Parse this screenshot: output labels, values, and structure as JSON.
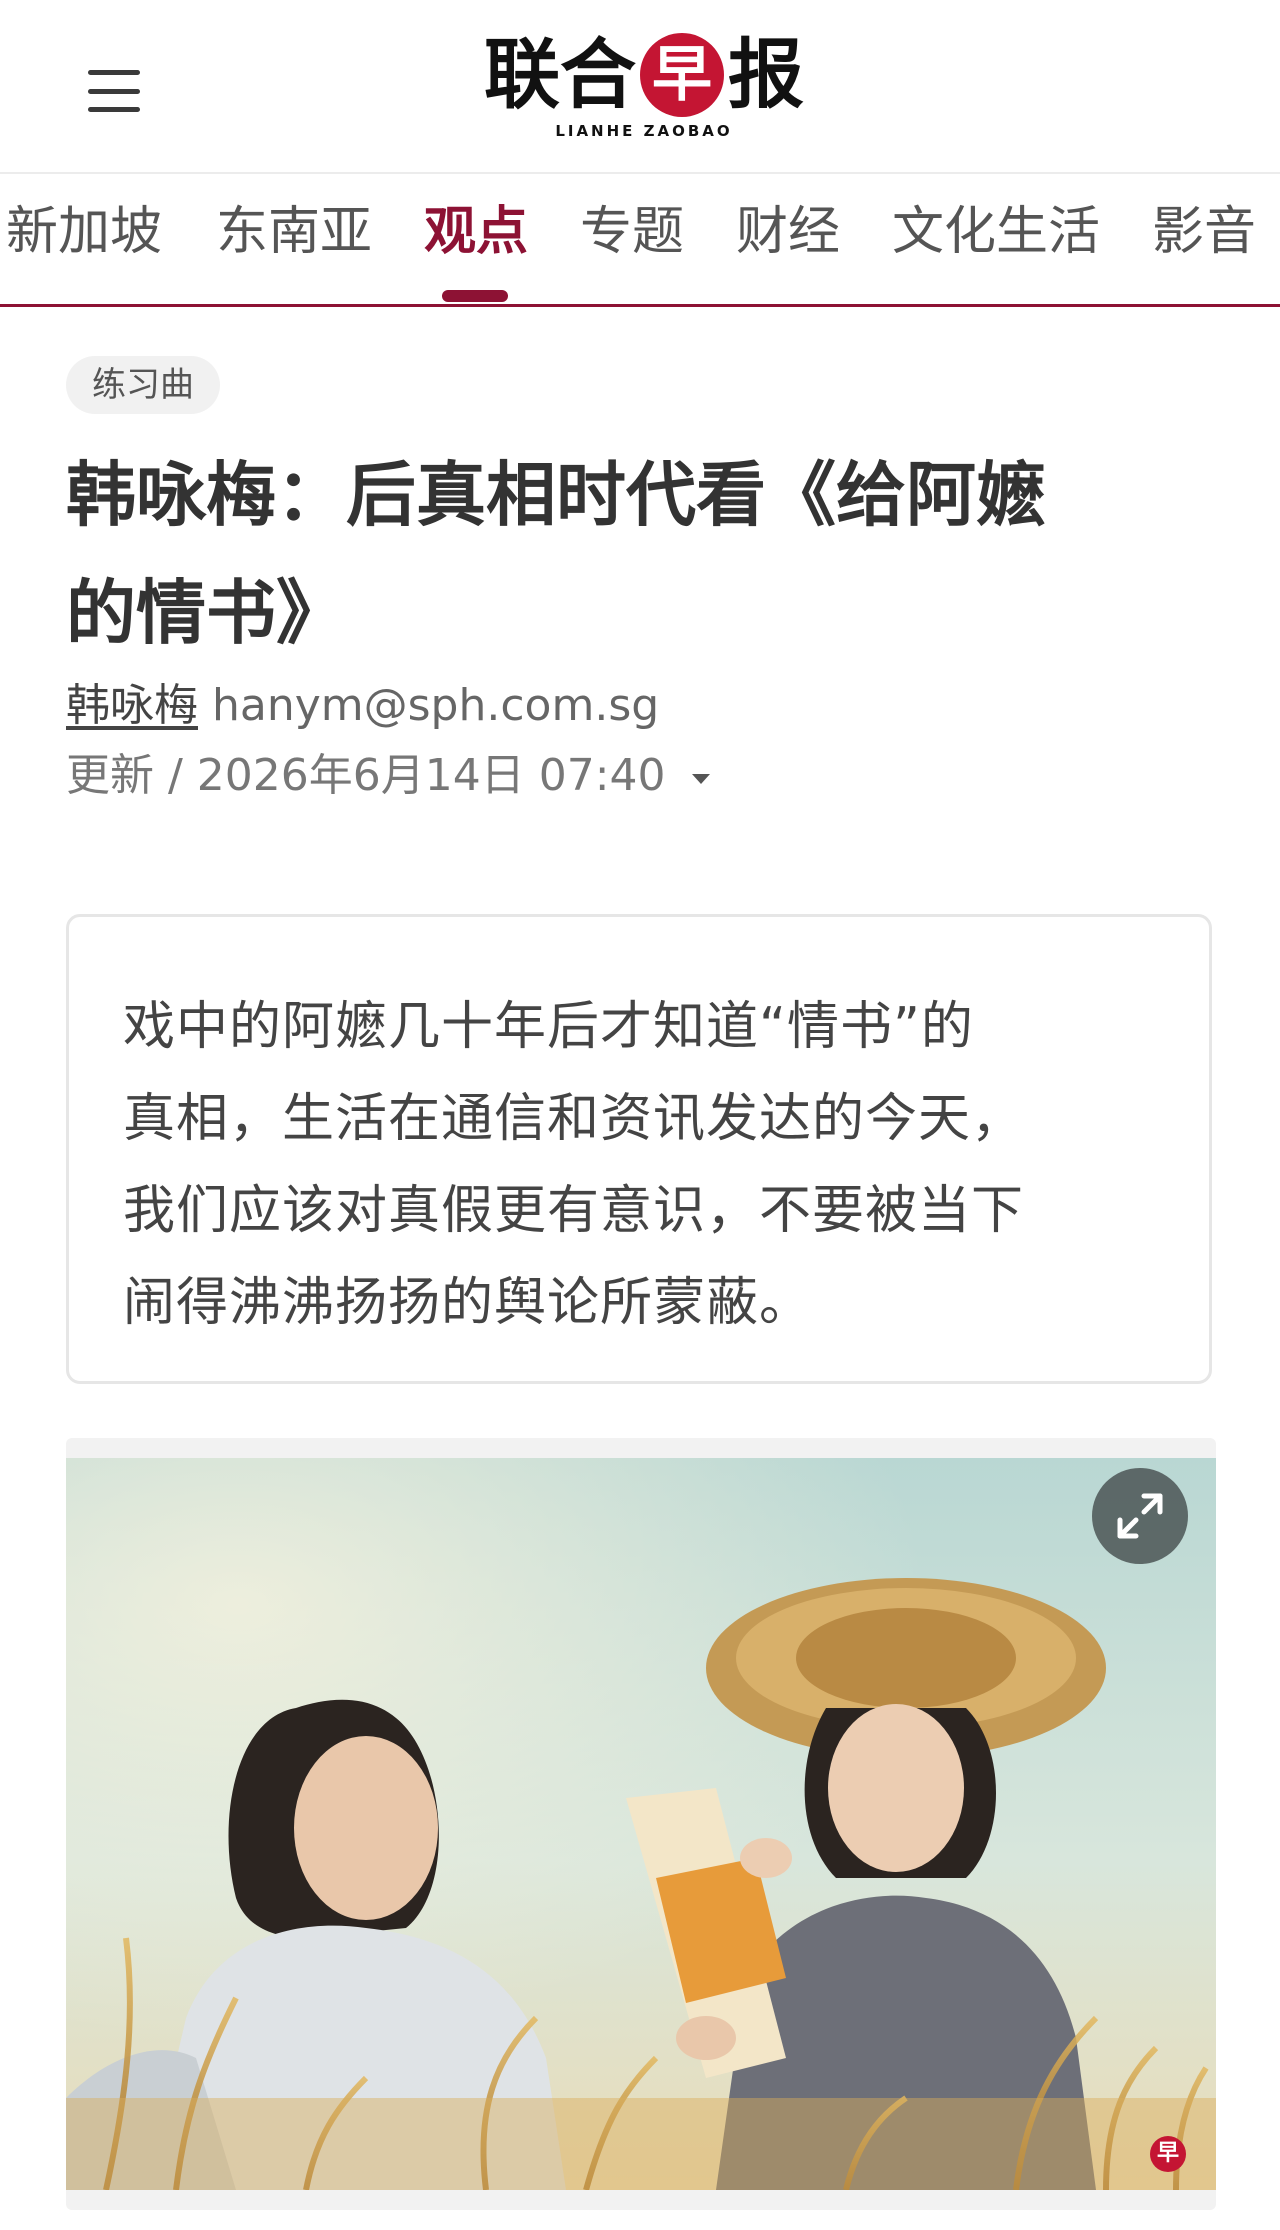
{
  "header": {
    "menu_icon": "hamburger-menu-icon",
    "logo": {
      "cn_before": "联合",
      "cn_circle": "早",
      "cn_after": "报",
      "en": "LIANHE ZAOBAO",
      "brand_color": "#c41533"
    }
  },
  "nav": {
    "accent_color": "#8d1234",
    "active_index": 2,
    "tabs": [
      {
        "label": "新加坡"
      },
      {
        "label": "东南亚"
      },
      {
        "label": "观点"
      },
      {
        "label": "专题"
      },
      {
        "label": "财经"
      },
      {
        "label": "文化生活"
      },
      {
        "label": "影音"
      }
    ]
  },
  "article": {
    "category": "练习曲",
    "title_line1": "韩咏梅：后真相时代看《给阿嬷",
    "title_line2": "的情书》",
    "author": "韩咏梅",
    "email": "hanym@sph.com.sg",
    "date_prefix": "更新 / ",
    "date": "2026年6月14日 07:40",
    "summary_lines": [
      "戏中的阿嬷几十年后才知道“情书”的",
      "真相，生活在通信和资讯发达的今天，",
      "我们应该对真假更有意识，不要被当下",
      "闹得沸沸扬扬的舆论所蒙蔽。"
    ],
    "image": {
      "expand_icon": "expand-arrows-icon",
      "watermark": "早"
    }
  }
}
